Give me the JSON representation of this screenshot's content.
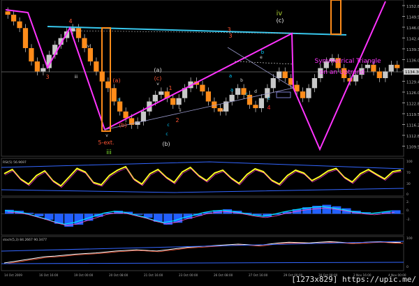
{
  "watermark": "[1273x829] https://upic.me/",
  "colors": {
    "bg": "#000000",
    "axis": "#9a9a9a",
    "grid": "#222222",
    "bull": "#ff8c1a",
    "bear": "#ff8c1a",
    "triangle": "#ff33ff",
    "cyanLine": "#38c8ee",
    "rsi": "#ffff22",
    "macd": "#2260ff"
  },
  "chart_data": [
    {
      "type": "candlestick",
      "title": "",
      "annotation": "Symmetrical Triangle\non an Uptrend",
      "y_ticks": [
        "1152.81",
        "1149.51",
        "1146.00",
        "1142.40",
        "1139.31",
        "1136.00",
        "1132.88",
        "1129.44",
        "1126.00",
        "1122.81",
        "1119.51",
        "1116.21",
        "1112.81",
        "1109.51"
      ],
      "price_label": "1134.36",
      "ylim": [
        1108,
        1154
      ],
      "x_ticks": [
        "14 Oct 2009",
        "16 Oct 16:00",
        "19 Oct 00:00",
        "20 Oct 08:00",
        "21 Oct 16:00",
        "23 Oct 00:00",
        "26 Oct 08:00",
        "27 Oct 16:00",
        "29 Oct 00:00",
        "30 Oct 08:00",
        "2 Nov 16:00",
        "4 Nov 00:00"
      ],
      "wave_labels": [
        "iv",
        "(c)",
        "3",
        "4",
        "iv",
        "iii",
        "3",
        "(a)",
        "(c)",
        "v",
        "1",
        "ii",
        "a",
        "b",
        "c",
        "5-ext.",
        "iii",
        "(b)",
        "2",
        "(a)",
        "(b)",
        "c",
        "3",
        "b",
        "a",
        "c",
        "e",
        "d",
        "a",
        "iv",
        "v",
        "4",
        "c"
      ],
      "close_prices": [
        1150,
        1148,
        1146,
        1140,
        1136,
        1133,
        1134,
        1138,
        1141,
        1143,
        1145,
        1146,
        1143,
        1140,
        1136,
        1133,
        1130,
        1128,
        1124,
        1121,
        1119,
        1117,
        1118,
        1121,
        1124,
        1126,
        1127,
        1125,
        1123,
        1125,
        1128,
        1130,
        1129,
        1127,
        1124,
        1122,
        1121,
        1124,
        1126,
        1128,
        1126,
        1123,
        1122,
        1125,
        1128,
        1131,
        1133,
        1131,
        1129,
        1127,
        1125,
        1128,
        1131,
        1134,
        1136,
        1137,
        1134,
        1131,
        1130,
        1132,
        1134,
        1135,
        1133,
        1131,
        1133,
        1135,
        1134
      ],
      "series": [
        {
          "name": "Symmetrical Triangle",
          "values": []
        }
      ]
    },
    {
      "type": "line",
      "title": "RSI(5) 56.9697",
      "ylim": [
        0,
        100
      ],
      "y_ticks": [
        "100",
        "70",
        "30",
        "0"
      ],
      "values": [
        60,
        72,
        45,
        30,
        55,
        68,
        40,
        25,
        50,
        75,
        65,
        35,
        28,
        55,
        70,
        80,
        45,
        30,
        60,
        72,
        50,
        35,
        65,
        78,
        55,
        40,
        62,
        70,
        48,
        32,
        58,
        74,
        66,
        42,
        30,
        55,
        70,
        62,
        40,
        52,
        68,
        75,
        50,
        36,
        60,
        72,
        58,
        45,
        66,
        70
      ]
    },
    {
      "type": "area",
      "title": "",
      "y_ticks": [
        "2.",
        "0.",
        "-2."
      ],
      "ylim": [
        -4,
        3
      ],
      "values": [
        0.8,
        0.6,
        0.2,
        -0.5,
        -1.2,
        -2.0,
        -2.6,
        -2.2,
        -1.4,
        -0.6,
        0.2,
        0.6,
        0.4,
        -0.2,
        -0.8,
        -1.6,
        -2.2,
        -1.8,
        -1.0,
        -0.4,
        0.3,
        0.7,
        0.9,
        0.6,
        0.2,
        -0.3,
        -0.6,
        -0.2,
        0.4,
        0.9,
        1.3,
        1.6,
        1.8,
        1.5,
        1.1,
        0.6,
        0.3,
        0.1,
        0.4,
        0.7
      ]
    },
    {
      "type": "line",
      "title": "stoch(5,3) 84.2667 90.3477",
      "ylim": [
        0,
        100
      ],
      "y_ticks": [
        "100",
        "0"
      ],
      "values": [
        20,
        25,
        30,
        35,
        40,
        42,
        45,
        48,
        50,
        52,
        55,
        58,
        60,
        62,
        60,
        58,
        62,
        66,
        70,
        72,
        74,
        76,
        78,
        80,
        78,
        76,
        80,
        84,
        86,
        85,
        84,
        86,
        88,
        86,
        84,
        85,
        87,
        88,
        86,
        85
      ]
    }
  ]
}
